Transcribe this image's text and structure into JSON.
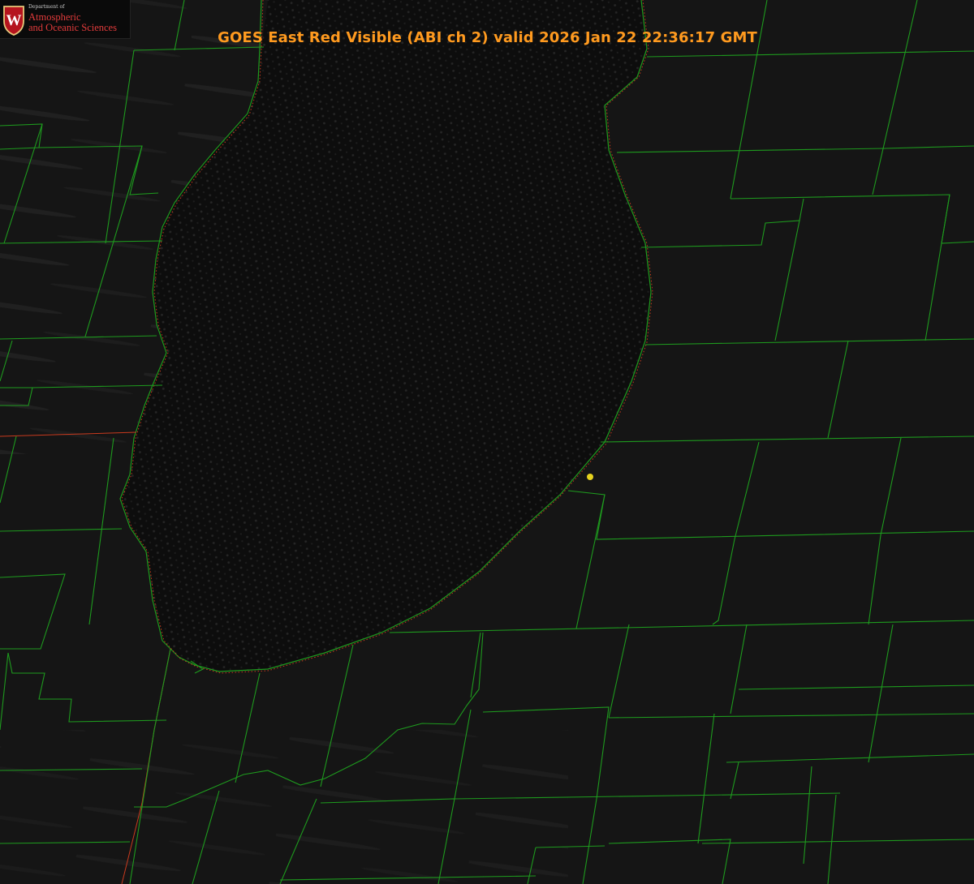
{
  "title": "GOES East Red Visible (ABI ch 2) valid 2026 Jan 22 22:36:17 GMT",
  "logo": {
    "department": "Department of",
    "line1": "Atmospheric",
    "line2": "and Oceanic Sciences",
    "emblem_letter": "W"
  },
  "colors": {
    "background": "#141414",
    "lake": "#0c0c0c",
    "county_lines": "#1e9a1e",
    "state_border": "#c83a1e",
    "title_text": "#ff9a1f",
    "marker": "#e6d21e"
  }
}
